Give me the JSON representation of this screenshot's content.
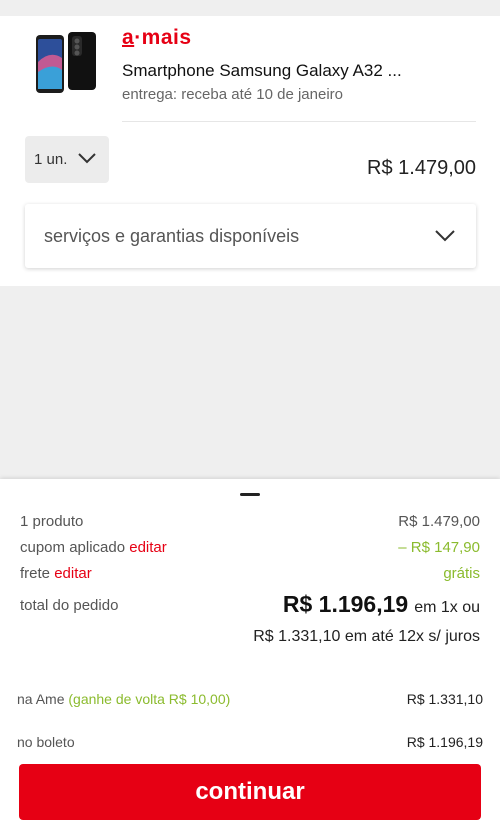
{
  "product": {
    "brand_prefix": "a",
    "brand_suffix": "·mais",
    "title": "Smartphone Samsung Galaxy A32 ...",
    "delivery": "entrega: receba até 10 de janeiro",
    "image_icon": "smartphone-icon",
    "quantity": "1 un.",
    "price": "R$ 1.479,00"
  },
  "services": {
    "label": "serviços e garantias disponíveis",
    "icon": "chevron-down-icon"
  },
  "summary": {
    "products_label": "1 produto",
    "products_value": "R$ 1.479,00",
    "coupon_label": "cupom aplicado",
    "coupon_edit": "editar",
    "coupon_value": "– R$ 147,90",
    "shipping_label": "frete",
    "shipping_edit": "editar",
    "shipping_value": "grátis",
    "total_label": "total do pedido",
    "total_value": "R$ 1.196,19",
    "total_suffix": "em 1x ou",
    "installments": "R$ 1.331,10 em até 12x s/ juros",
    "ame_label": "na Ame",
    "ame_cashback": "(ganhe de volta R$ 10,00)",
    "ame_value": "R$ 1.331,10",
    "boleto_label": "no boleto",
    "boleto_value": "R$ 1.196,19",
    "continue_label": "continuar"
  },
  "colors": {
    "brand_red": "#e60014",
    "discount_green": "#8bbb2e"
  }
}
